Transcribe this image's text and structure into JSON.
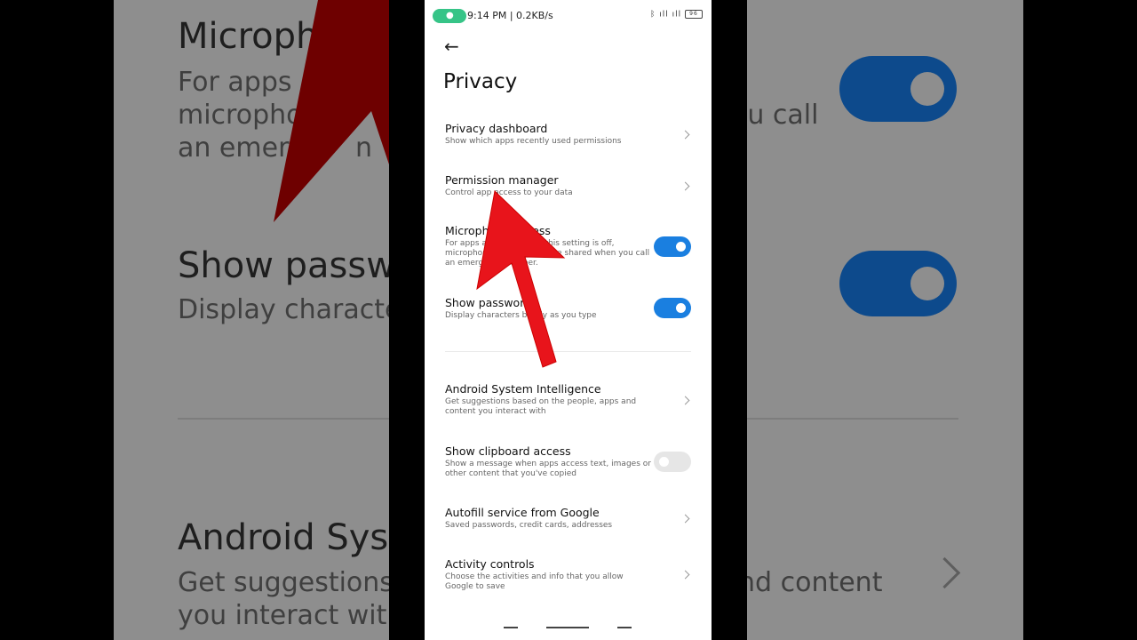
{
  "background_zoom": {
    "left_title_1": "Microph",
    "left_sub_1a": "For apps",
    "left_sub_1b": "micropho",
    "left_sub_1c": "an emer",
    "left_sub_1d": "n",
    "left_title_2": "Show passwo",
    "left_sub_2": "Display characte",
    "left_title_3": "Android Syst",
    "left_sub_3a": "Get suggestions",
    "left_sub_3b": "you interact wit",
    "right_sub_1": "ou call",
    "right_sub_3": "nd content"
  },
  "status_bar": {
    "mic_icon": "mic-icon",
    "time_speed": "9:14 PM | 0.2KB/s",
    "signal": "ᛒ ıll ıll",
    "battery": "96"
  },
  "header": {
    "back_icon": "←",
    "title": "Privacy"
  },
  "items": [
    {
      "title": "Privacy dashboard",
      "subtitle": "Show which apps recently used permissions"
    },
    {
      "title": "Permission manager",
      "subtitle": "Control app access to your data"
    },
    {
      "title": "Microphone access",
      "subtitle": "For apps and services. If this setting is off, microphone data may still be shared when you call an emergency number.",
      "toggle": "on"
    },
    {
      "title": "Show passwords",
      "subtitle": "Display characters briefly as you type",
      "toggle": "on"
    },
    {
      "title": "Android System Intelligence",
      "subtitle": "Get suggestions based on the people, apps and content you interact with"
    },
    {
      "title": "Show clipboard access",
      "subtitle": "Show a message when apps access text, images or other content that you've copied",
      "toggle": "off"
    },
    {
      "title": "Autofill service from Google",
      "subtitle": "Saved passwords, credit cards, addresses"
    },
    {
      "title": "Activity controls",
      "subtitle": "Choose the activities and info that you allow Google to save"
    }
  ],
  "colors": {
    "toggle_on": "#1a7fe0",
    "toggle_off": "#e6e6e6",
    "annotation_arrow": "#e8141b",
    "mic_pill": "#36c487"
  }
}
